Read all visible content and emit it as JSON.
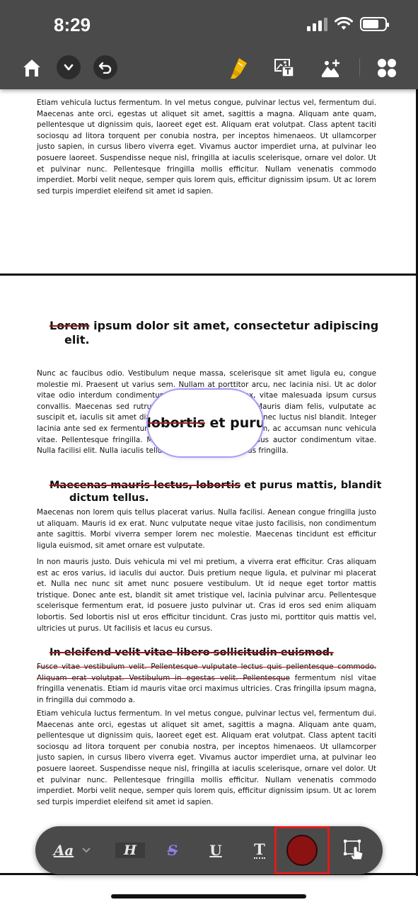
{
  "status_bar": {
    "time": "8:29"
  },
  "top_toolbar": {
    "icons": [
      "home-icon",
      "chevron-down-icon",
      "undo-icon",
      "highlighter-icon",
      "image-text-icon",
      "image-add-icon",
      "apps-grid-icon"
    ],
    "accent_color": "#f5b800"
  },
  "document": {
    "para_top": "Etiam vehicula luctus fermentum. In vel metus congue, pulvinar lectus vel, fermentum dui. Maecenas ante orci, egestas ut aliquet sit amet, sagittis a magna. Aliquam ante quam, pellentesque ut dignissim quis, laoreet eget est. Aliquam erat volutpat. Class aptent taciti sociosqu ad litora torquent per conubia nostra, per inceptos himenaeos. Ut ullamcorper justo sapien, in cursus libero viverra eget. Vivamus auctor imperdiet urna, at pulvinar leo posuere laoreet. Suspendisse neque nisl, fringilla at iaculis scelerisque, ornare vel dolor. Ut et pulvinar nunc. Pellentesque fringilla mollis efficitur. Nullam venenatis commodo imperdiet. Morbi velit neque, semper quis lorem quis, efficitur dignissim ipsum. Ut ac lorem sed turpis imperdiet eleifend sit amet id sapien.",
    "heading1": {
      "struck": "Lorem",
      "rest": " ipsum dolor sit amet, consectetur adipiscing",
      "line2": "elit."
    },
    "para1": "Nunc ac faucibus odio. Vestibulum neque massa, scelerisque sit amet ligula eu, congue molestie mi. Praesent ut varius sem. Nullam at porttitor arcu, nec lacinia nisi. Ut ac dolor vitae odio interdum condimentum. Nunc sed sodales ex, vitae malesuada ipsum cursus convallis. Maecenas sed rutrum lectus, fermentum orci. Mauris diam felis, vulputate ac suscipit et, iaculis sit amet diam. Nunc eu ac ligula semper, nec luctus nisl blandit. Integer lacinia ante sed ex fermentum. Nullam mollis convallis ipsum, ac accumsan nunc vehicula vitae. Pellentesque fringilla. Morbi sit amet tortor quis risus auctor condimentum vitae. Nulla facilisi elit. Nulla iaculis tellus sit amet mauris tempus fringilla.",
    "magnifier": {
      "prefix": ", ",
      "struck": "lobortis",
      "rest": " et purus"
    },
    "heading2": {
      "struck": "Maecenas mauris lectus, lobortis",
      "rest": " et purus mattis, blandit",
      "line2": "dictum tellus."
    },
    "para2": "Maecenas non lorem quis tellus placerat varius. Nulla facilisi. Aenean congue fringilla justo ut aliquam. Mauris id ex erat. Nunc vulputate neque vitae justo facilisis, non condimentum ante sagittis. Morbi viverra semper lorem nec molestie. Maecenas tincidunt est efficitur ligula euismod, sit amet ornare est vulputate.",
    "para3": "In non mauris justo. Duis vehicula mi vel mi pretium, a viverra erat efficitur. Cras aliquam est ac eros varius, id iaculis dui auctor. Duis pretium neque ligula, et pulvinar mi placerat et. Nulla nec nunc sit amet nunc posuere vestibulum. Ut id neque eget tortor mattis tristique. Donec ante est, blandit sit amet tristique vel, lacinia pulvinar arcu. Pellentesque scelerisque fermentum erat, id posuere justo pulvinar ut. Cras id eros sed enim aliquam lobortis. Sed lobortis nisl ut eros efficitur tincidunt. Cras justo mi, porttitor quis mattis vel, ultricies ut purus. Ut facilisis et lacus eu cursus.",
    "heading3": {
      "struck": "In eleifend velit vitae libero sollicitudin euismod."
    },
    "para4": {
      "struck": "Fusce vitae vestibulum velit. Pellentesque vulputate lectus quis pellentesque commodo. Aliquam erat volutpat. Vestibulum in egestas velit. Pellentesque",
      "rest": " fermentum nisl vitae fringilla venenatis. Etiam id mauris vitae orci maximus ultricies. Cras fringilla ipsum magna, in fringilla dui commodo a."
    },
    "para5": "Etiam vehicula luctus fermentum. In vel metus congue, pulvinar lectus vel, fermentum dui. Maecenas ante orci, egestas ut aliquet sit amet, sagittis a magna. Aliquam ante quam, pellentesque ut dignissim quis, laoreet eget est. Aliquam erat volutpat. Class aptent taciti sociosqu ad litora torquent per conubia nostra, per inceptos himenaeos. Ut ullamcorper justo sapien, in cursus libero viverra eget. Vivamus auctor imperdiet urna, at pulvinar leo posuere laoreet. Suspendisse neque nisl, fringilla at iaculis scelerisque, ornare vel dolor. Ut et pulvinar nunc. Pellentesque fringilla mollis efficitur. Nullam venenatis commodo imperdiet. Morbi velit neque, semper quis lorem quis, efficitur dignissim ipsum. Ut ac lorem sed turpis imperdiet eleifend sit amet id sapien."
  },
  "bottom_toolbar": {
    "font_label": "Aa",
    "heading_label": "H",
    "strike_label": "S",
    "underline_label": "U",
    "text_label": "T",
    "strike_color": "#8f7fe8",
    "selected_color": "#8b1212",
    "highlight_border": "#e01b1b"
  }
}
